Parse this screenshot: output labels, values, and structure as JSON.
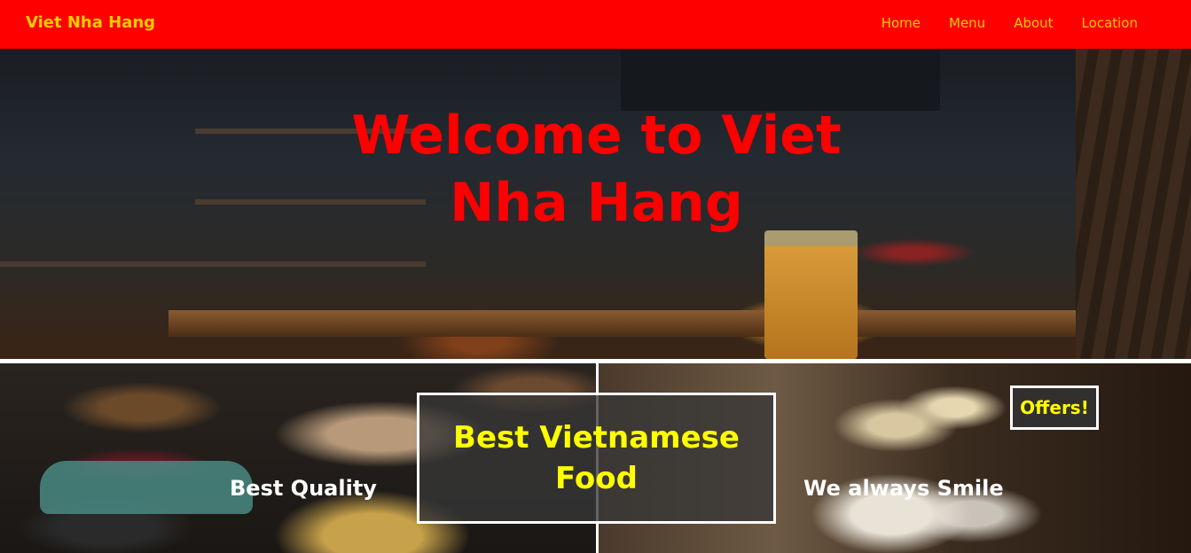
{
  "navbar": {
    "brand": "Viet Nha Hang",
    "links": [
      "Home",
      "Menu",
      "About",
      "Location"
    ]
  },
  "hero": {
    "title": "Welcome to Viet Nha Hang"
  },
  "panels": {
    "left_caption": "Best Quality",
    "center_text": "Best Vietnamese Food",
    "right_caption": "We always Smile",
    "offers_label": "Offers!"
  },
  "colors": {
    "navbar_bg": "#ff0000",
    "brand_text": "#ffcc00",
    "hero_title": "#ff0000",
    "highlight_text": "#ffff00"
  }
}
